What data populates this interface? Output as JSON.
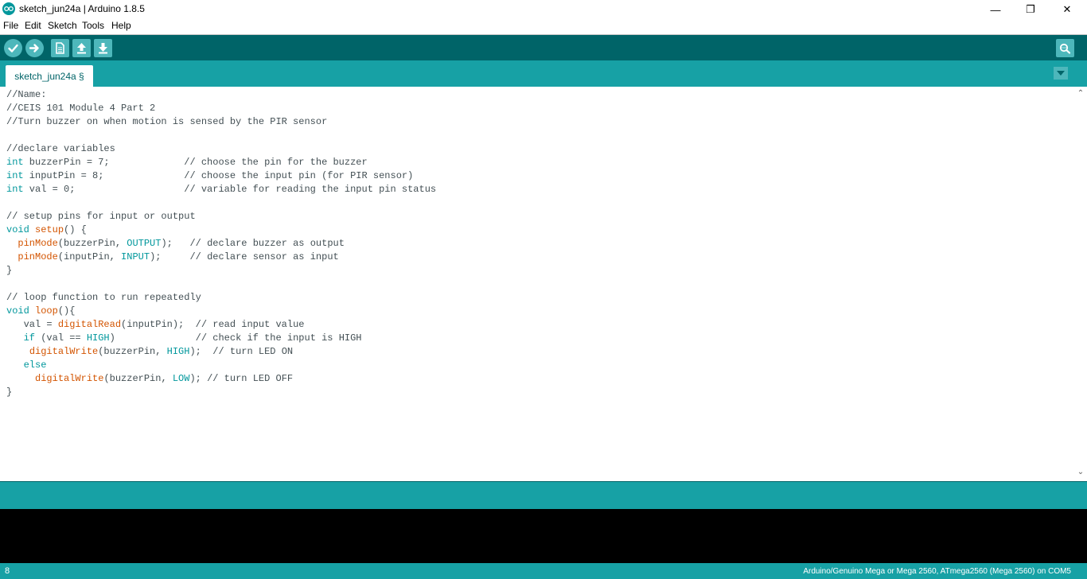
{
  "window": {
    "title": "sketch_jun24a | Arduino 1.8.5",
    "minimize_glyph": "—",
    "maximize_glyph": "❐",
    "close_glyph": "✕"
  },
  "menu": [
    "File",
    "Edit",
    "Sketch",
    "Tools",
    "Help"
  ],
  "toolbar": {
    "buttons": [
      "verify-icon",
      "upload-icon",
      "new-icon",
      "open-icon",
      "save-icon",
      "serial-monitor-icon"
    ]
  },
  "tabs": [
    {
      "label": "sketch_jun24a §",
      "active": true
    }
  ],
  "code": [
    "//Name:",
    "//CEIS 101 Module 4 Part 2",
    "//Turn buzzer on when motion is sensed by the PIR sensor",
    "",
    "//declare variables",
    "int buzzerPin = 7;             // choose the pin for the buzzer",
    "int inputPin = 8;              // choose the input pin (for PIR sensor)",
    "int val = 0;                   // variable for reading the input pin status",
    "",
    "// setup pins for input or output",
    "void setup() {",
    "  pinMode(buzzerPin, OUTPUT);   // declare buzzer as output",
    "  pinMode(inputPin, INPUT);     // declare sensor as input",
    "}",
    "",
    "// loop function to run repeatedly",
    "void loop(){",
    "   val = digitalRead(inputPin);  // read input value",
    "   if (val == HIGH)              // check if the input is HIGH",
    "    digitalWrite(buzzerPin, HIGH);  // turn LED ON",
    "   else",
    "     digitalWrite(buzzerPin, LOW); // turn LED OFF",
    "}"
  ],
  "status": {
    "line_number": "8",
    "board": "Arduino/Genuino Mega or Mega 2560, ATmega2560 (Mega 2560) on COM5"
  },
  "colors": {
    "toolbar_bg": "#006468",
    "tabbar_bg": "#17a1a5",
    "keyword": "#00979c",
    "function": "#d35400",
    "comment": "#434f54"
  }
}
